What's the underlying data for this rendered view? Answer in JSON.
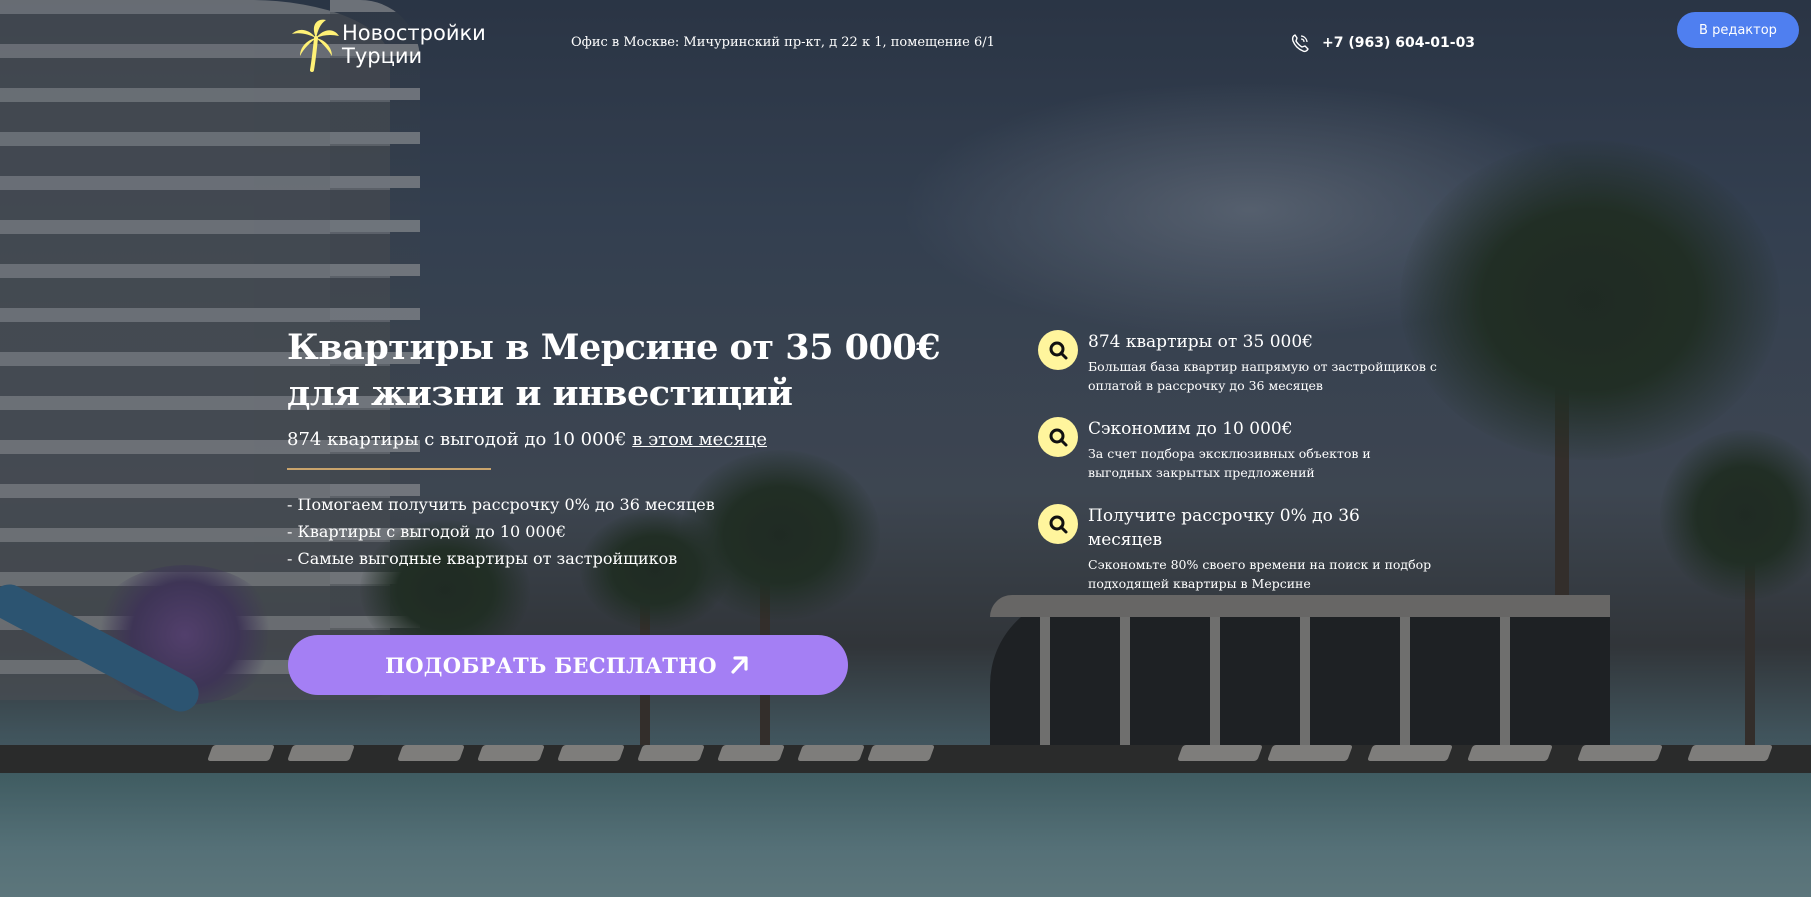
{
  "header": {
    "logo_line1": "Новостройки",
    "logo_line2": "Турции",
    "office": "Офис в Москве: Мичуринский пр-кт, д 22 к 1, помещение 6/1",
    "phone": "+7 (963) 604-01-03",
    "editor_button": "В редактор"
  },
  "hero": {
    "title": "Квартиры в Мерсине от 35 000€ для жизни и инвестиций",
    "subtitle_text": "874 квартиры с выгодой до 10 000€ ",
    "subtitle_link": "в этом месяце",
    "bullets": [
      "- Помогаем получить рассрочку 0% до 36 месяцев",
      "- Квартиры с выгодой до 10 000€",
      "- Самые выгодные квартиры от застройщиков"
    ],
    "cta_label": "ПОДОБРАТЬ БЕСПЛАТНО"
  },
  "features": [
    {
      "title": "874 квартиры от 35 000€",
      "desc": "Большая база квартир напрямую от застройщиков с оплатой в рассрочку до 36 месяцев"
    },
    {
      "title": "Сэкономим до 10 000€",
      "desc": "За счет подбора эксклюзивных объектов и выгодных закрытых предложений"
    },
    {
      "title": "Получите рассрочку 0% до 36 месяцев",
      "desc": "Сэкономьте 80% своего времени на поиск и подбор подходящей квартиры в Мерсине"
    }
  ],
  "colors": {
    "cta": "#a47ff4",
    "editor_button": "#4f7ff0",
    "feature_icon_bg": "#fff59d",
    "logo": "#fff176",
    "divider": "#c9a46c"
  },
  "icons": {
    "logo": "palm-tree-icon",
    "phone": "phone-icon",
    "cta": "arrow-up-right-icon",
    "feature": "search-magnifier-icon"
  }
}
